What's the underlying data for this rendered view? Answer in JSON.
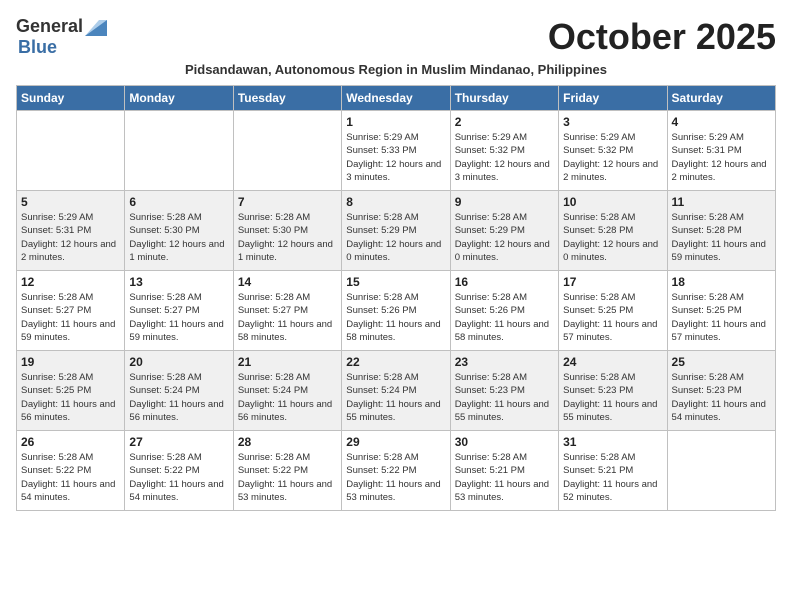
{
  "logo": {
    "general": "General",
    "blue": "Blue"
  },
  "title": "October 2025",
  "subtitle": "Pidsandawan, Autonomous Region in Muslim Mindanao, Philippines",
  "days_of_week": [
    "Sunday",
    "Monday",
    "Tuesday",
    "Wednesday",
    "Thursday",
    "Friday",
    "Saturday"
  ],
  "weeks": [
    [
      {
        "day": "",
        "sunrise": "",
        "sunset": "",
        "daylight": ""
      },
      {
        "day": "",
        "sunrise": "",
        "sunset": "",
        "daylight": ""
      },
      {
        "day": "",
        "sunrise": "",
        "sunset": "",
        "daylight": ""
      },
      {
        "day": "1",
        "sunrise": "Sunrise: 5:29 AM",
        "sunset": "Sunset: 5:33 PM",
        "daylight": "Daylight: 12 hours and 3 minutes."
      },
      {
        "day": "2",
        "sunrise": "Sunrise: 5:29 AM",
        "sunset": "Sunset: 5:32 PM",
        "daylight": "Daylight: 12 hours and 3 minutes."
      },
      {
        "day": "3",
        "sunrise": "Sunrise: 5:29 AM",
        "sunset": "Sunset: 5:32 PM",
        "daylight": "Daylight: 12 hours and 2 minutes."
      },
      {
        "day": "4",
        "sunrise": "Sunrise: 5:29 AM",
        "sunset": "Sunset: 5:31 PM",
        "daylight": "Daylight: 12 hours and 2 minutes."
      }
    ],
    [
      {
        "day": "5",
        "sunrise": "Sunrise: 5:29 AM",
        "sunset": "Sunset: 5:31 PM",
        "daylight": "Daylight: 12 hours and 2 minutes."
      },
      {
        "day": "6",
        "sunrise": "Sunrise: 5:28 AM",
        "sunset": "Sunset: 5:30 PM",
        "daylight": "Daylight: 12 hours and 1 minute."
      },
      {
        "day": "7",
        "sunrise": "Sunrise: 5:28 AM",
        "sunset": "Sunset: 5:30 PM",
        "daylight": "Daylight: 12 hours and 1 minute."
      },
      {
        "day": "8",
        "sunrise": "Sunrise: 5:28 AM",
        "sunset": "Sunset: 5:29 PM",
        "daylight": "Daylight: 12 hours and 0 minutes."
      },
      {
        "day": "9",
        "sunrise": "Sunrise: 5:28 AM",
        "sunset": "Sunset: 5:29 PM",
        "daylight": "Daylight: 12 hours and 0 minutes."
      },
      {
        "day": "10",
        "sunrise": "Sunrise: 5:28 AM",
        "sunset": "Sunset: 5:28 PM",
        "daylight": "Daylight: 12 hours and 0 minutes."
      },
      {
        "day": "11",
        "sunrise": "Sunrise: 5:28 AM",
        "sunset": "Sunset: 5:28 PM",
        "daylight": "Daylight: 11 hours and 59 minutes."
      }
    ],
    [
      {
        "day": "12",
        "sunrise": "Sunrise: 5:28 AM",
        "sunset": "Sunset: 5:27 PM",
        "daylight": "Daylight: 11 hours and 59 minutes."
      },
      {
        "day": "13",
        "sunrise": "Sunrise: 5:28 AM",
        "sunset": "Sunset: 5:27 PM",
        "daylight": "Daylight: 11 hours and 59 minutes."
      },
      {
        "day": "14",
        "sunrise": "Sunrise: 5:28 AM",
        "sunset": "Sunset: 5:27 PM",
        "daylight": "Daylight: 11 hours and 58 minutes."
      },
      {
        "day": "15",
        "sunrise": "Sunrise: 5:28 AM",
        "sunset": "Sunset: 5:26 PM",
        "daylight": "Daylight: 11 hours and 58 minutes."
      },
      {
        "day": "16",
        "sunrise": "Sunrise: 5:28 AM",
        "sunset": "Sunset: 5:26 PM",
        "daylight": "Daylight: 11 hours and 58 minutes."
      },
      {
        "day": "17",
        "sunrise": "Sunrise: 5:28 AM",
        "sunset": "Sunset: 5:25 PM",
        "daylight": "Daylight: 11 hours and 57 minutes."
      },
      {
        "day": "18",
        "sunrise": "Sunrise: 5:28 AM",
        "sunset": "Sunset: 5:25 PM",
        "daylight": "Daylight: 11 hours and 57 minutes."
      }
    ],
    [
      {
        "day": "19",
        "sunrise": "Sunrise: 5:28 AM",
        "sunset": "Sunset: 5:25 PM",
        "daylight": "Daylight: 11 hours and 56 minutes."
      },
      {
        "day": "20",
        "sunrise": "Sunrise: 5:28 AM",
        "sunset": "Sunset: 5:24 PM",
        "daylight": "Daylight: 11 hours and 56 minutes."
      },
      {
        "day": "21",
        "sunrise": "Sunrise: 5:28 AM",
        "sunset": "Sunset: 5:24 PM",
        "daylight": "Daylight: 11 hours and 56 minutes."
      },
      {
        "day": "22",
        "sunrise": "Sunrise: 5:28 AM",
        "sunset": "Sunset: 5:24 PM",
        "daylight": "Daylight: 11 hours and 55 minutes."
      },
      {
        "day": "23",
        "sunrise": "Sunrise: 5:28 AM",
        "sunset": "Sunset: 5:23 PM",
        "daylight": "Daylight: 11 hours and 55 minutes."
      },
      {
        "day": "24",
        "sunrise": "Sunrise: 5:28 AM",
        "sunset": "Sunset: 5:23 PM",
        "daylight": "Daylight: 11 hours and 55 minutes."
      },
      {
        "day": "25",
        "sunrise": "Sunrise: 5:28 AM",
        "sunset": "Sunset: 5:23 PM",
        "daylight": "Daylight: 11 hours and 54 minutes."
      }
    ],
    [
      {
        "day": "26",
        "sunrise": "Sunrise: 5:28 AM",
        "sunset": "Sunset: 5:22 PM",
        "daylight": "Daylight: 11 hours and 54 minutes."
      },
      {
        "day": "27",
        "sunrise": "Sunrise: 5:28 AM",
        "sunset": "Sunset: 5:22 PM",
        "daylight": "Daylight: 11 hours and 54 minutes."
      },
      {
        "day": "28",
        "sunrise": "Sunrise: 5:28 AM",
        "sunset": "Sunset: 5:22 PM",
        "daylight": "Daylight: 11 hours and 53 minutes."
      },
      {
        "day": "29",
        "sunrise": "Sunrise: 5:28 AM",
        "sunset": "Sunset: 5:22 PM",
        "daylight": "Daylight: 11 hours and 53 minutes."
      },
      {
        "day": "30",
        "sunrise": "Sunrise: 5:28 AM",
        "sunset": "Sunset: 5:21 PM",
        "daylight": "Daylight: 11 hours and 53 minutes."
      },
      {
        "day": "31",
        "sunrise": "Sunrise: 5:28 AM",
        "sunset": "Sunset: 5:21 PM",
        "daylight": "Daylight: 11 hours and 52 minutes."
      },
      {
        "day": "",
        "sunrise": "",
        "sunset": "",
        "daylight": ""
      }
    ]
  ]
}
